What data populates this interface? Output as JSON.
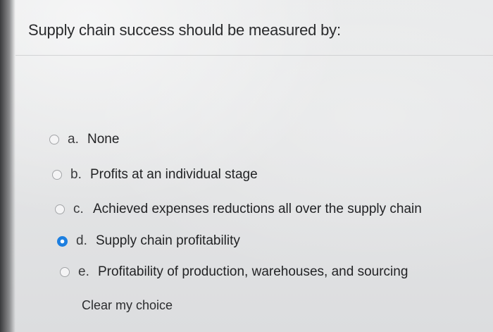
{
  "question": {
    "text": "Supply chain success should be measured by:"
  },
  "options": [
    {
      "letter": "a.",
      "text": "None",
      "selected": false
    },
    {
      "letter": "b.",
      "text": "Profits at an individual stage",
      "selected": false
    },
    {
      "letter": "c.",
      "text": "Achieved expenses reductions all over the supply chain",
      "selected": false
    },
    {
      "letter": "d.",
      "text": "Supply chain profitability",
      "selected": true
    },
    {
      "letter": "e.",
      "text": "Profitability of production, warehouses, and sourcing",
      "selected": false
    }
  ],
  "clear_choice": {
    "label": "Clear my choice"
  },
  "colors": {
    "selected_radio": "#1d7fe0",
    "text": "#2c2d2f"
  },
  "icons": {
    "radio_unselected": "radio-empty-icon",
    "radio_selected": "radio-filled-icon"
  }
}
